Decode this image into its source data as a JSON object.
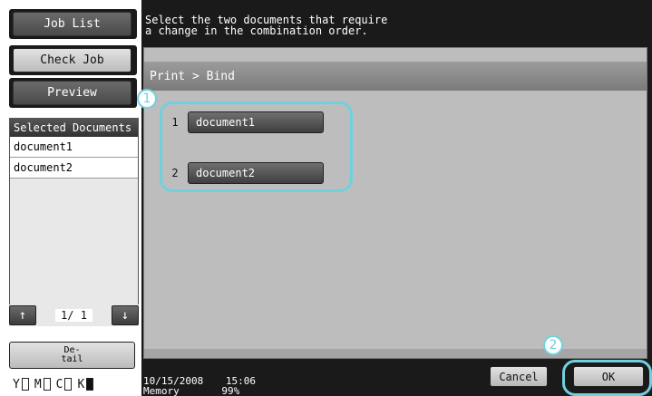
{
  "left_panel": {
    "job_list_label": "Job List",
    "check_job_label": "Check Job",
    "preview_label": "Preview",
    "selected_documents": {
      "header": "Selected Documents",
      "items": [
        "document1",
        "document2"
      ]
    },
    "pager": {
      "page_indicator": "1/ 1",
      "up_icon": "arrow-up-icon",
      "down_icon": "arrow-down-icon"
    },
    "detail_label_line1": "De-",
    "detail_label_line2": "tail",
    "toner": [
      "Y",
      "M",
      "C",
      "K"
    ]
  },
  "message": {
    "line1": "Select the two documents that require",
    "line2": "a change in the combination order."
  },
  "content": {
    "header": "Print > Bind",
    "documents": [
      {
        "number": "1",
        "label": "document1"
      },
      {
        "number": "2",
        "label": "document2"
      }
    ]
  },
  "callouts": {
    "first": "1",
    "second": "2"
  },
  "footer": {
    "date": "10/15/2008",
    "time": "15:06",
    "memory_label": "Memory",
    "memory_value": "99%",
    "cancel_label": "Cancel",
    "ok_label": "OK"
  },
  "colors": {
    "highlight": "#6fd1de",
    "panel_bg": "#1a1a1a",
    "content_bg": "#bdbdbd"
  }
}
